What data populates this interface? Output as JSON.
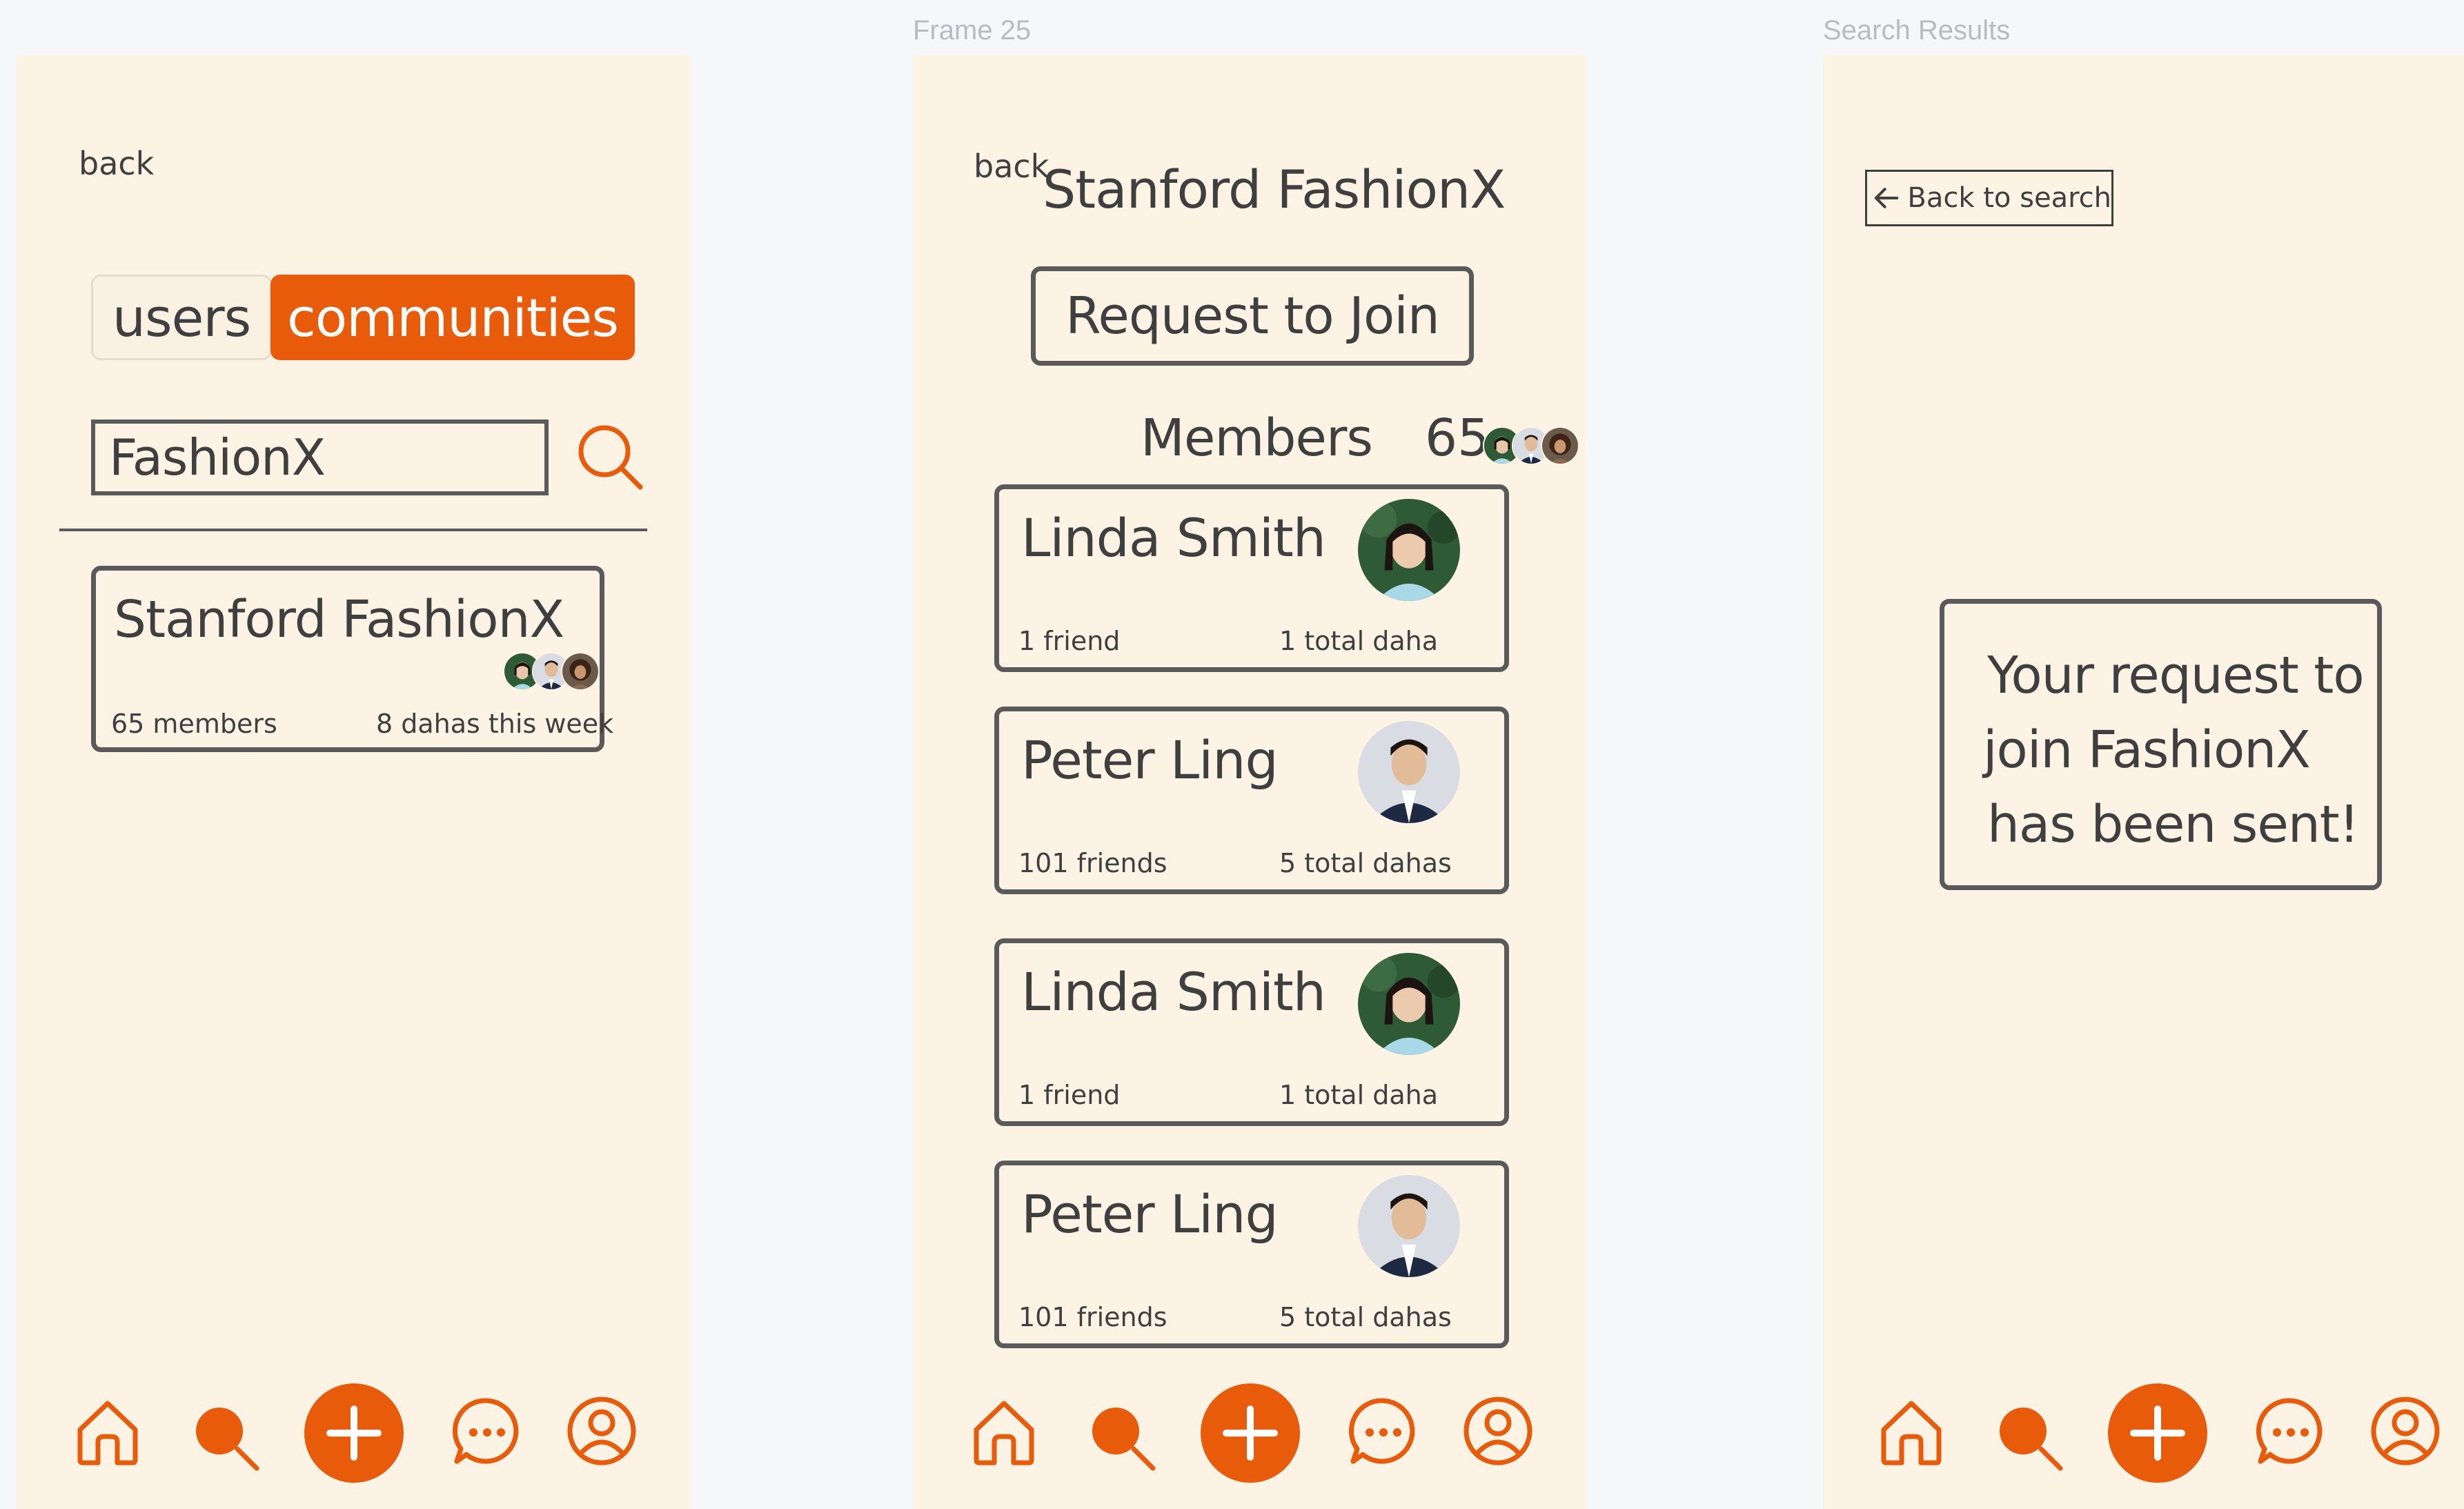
{
  "canvas": {
    "labels": [
      "",
      "Frame 25",
      "Search Results"
    ]
  },
  "screen1": {
    "back_label": "back",
    "tabs": [
      {
        "label": "users",
        "selected": false
      },
      {
        "label": "communities",
        "selected": true
      }
    ],
    "search": {
      "value": "FashionX"
    },
    "result": {
      "title": "Stanford FashionX",
      "members": "65 members",
      "activity": "8 dahas this week"
    }
  },
  "screen2": {
    "back_label": "back",
    "title": "Stanford FashionX",
    "join_label": "Request to Join",
    "members_label": "Members",
    "members_count": "65",
    "members": [
      {
        "name": "Linda Smith",
        "friends": "1 friend",
        "dahas": "1 total daha",
        "avatar": "woman-avatar"
      },
      {
        "name": "Peter Ling",
        "friends": "101 friends",
        "dahas": "5 total dahas",
        "avatar": "man-avatar"
      },
      {
        "name": "Linda Smith",
        "friends": "1 friend",
        "dahas": "1 total daha",
        "avatar": "woman-avatar"
      },
      {
        "name": "Peter Ling",
        "friends": "101 friends",
        "dahas": "5 total dahas",
        "avatar": "man-avatar"
      }
    ]
  },
  "screen3": {
    "back_button_label": "Back to search",
    "notice_lines": [
      "Your request to",
      "join FashionX",
      "has been sent!"
    ]
  },
  "nav": {
    "icons": [
      "home-icon",
      "search-icon",
      "plus-icon",
      "chat-icon",
      "profile-icon"
    ]
  },
  "colors": {
    "accent": "#E85B0B",
    "screen_bg": "#FDF3E4",
    "canvas_bg": "#F5F7F8",
    "border": "#5a5a5a",
    "text": "#3f3f3f",
    "frame_label": "#b8bcc0"
  }
}
